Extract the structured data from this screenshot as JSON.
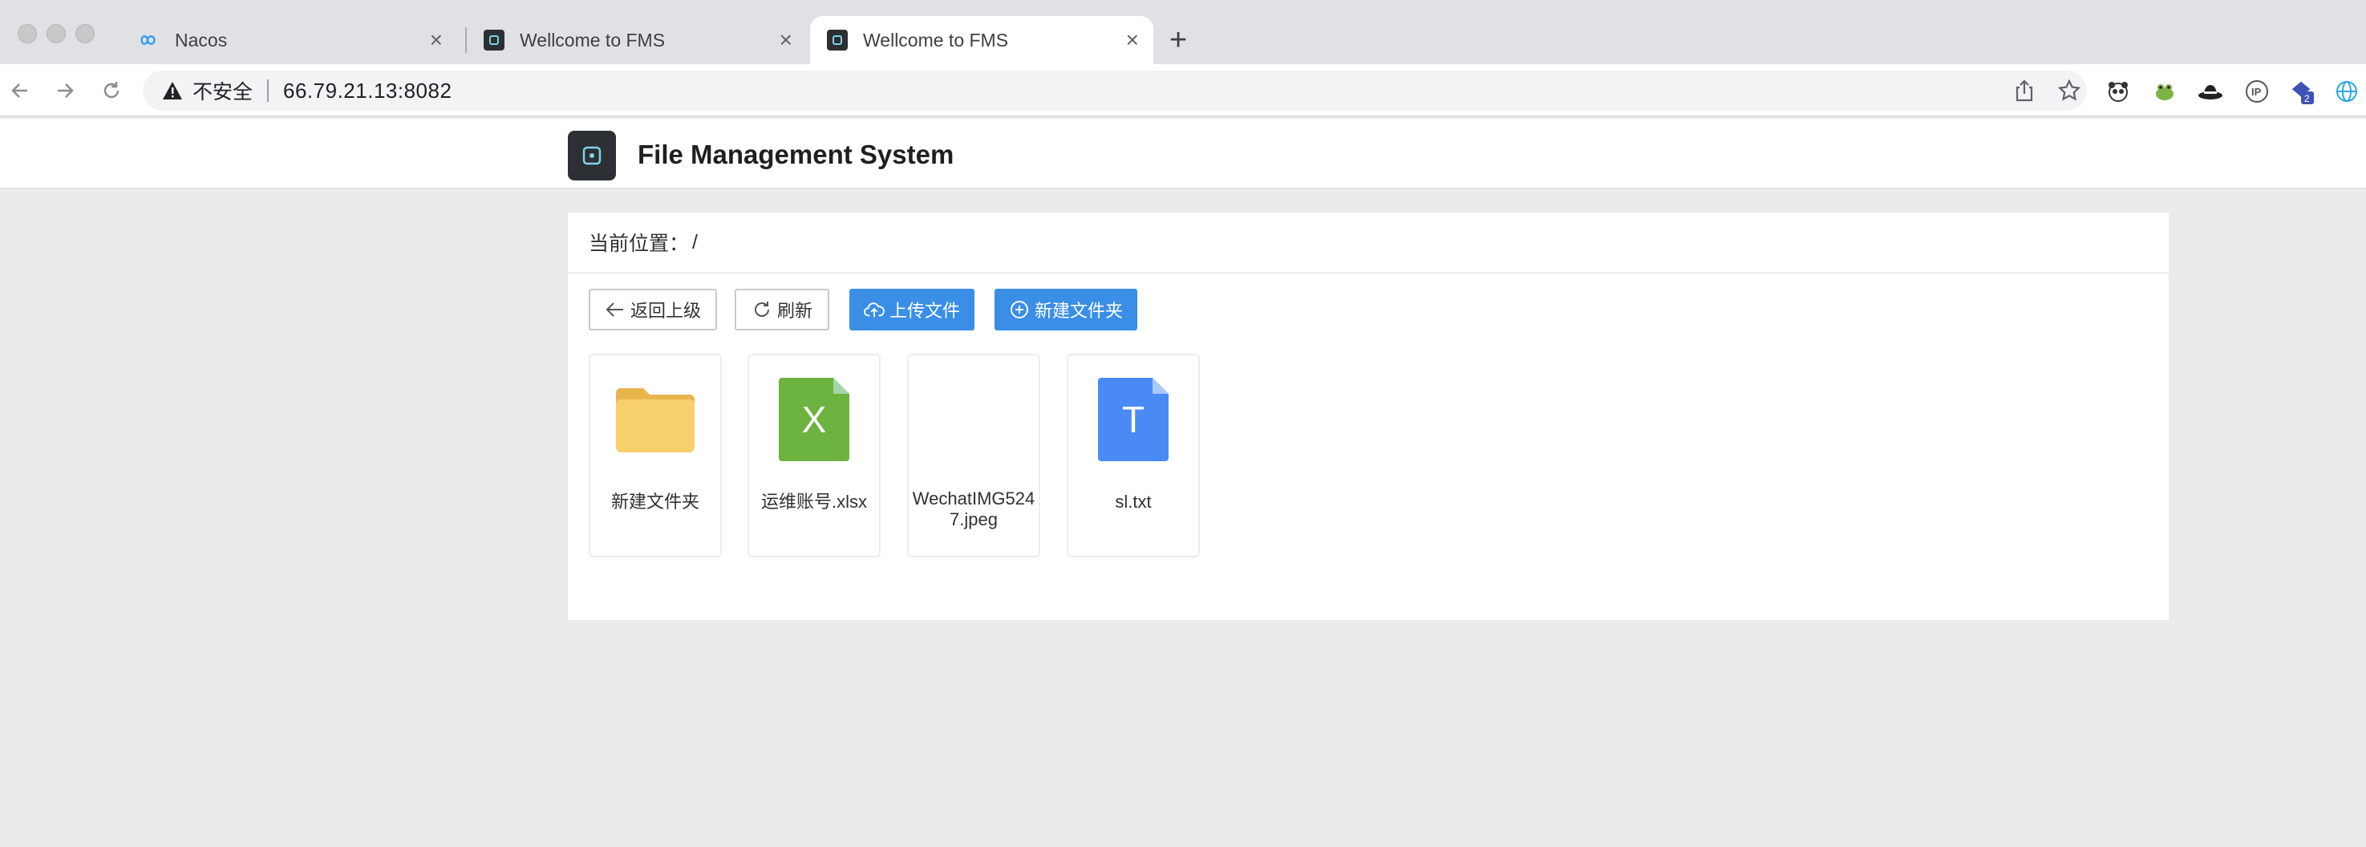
{
  "browser": {
    "tabs": [
      {
        "title": "Nacos",
        "active": false,
        "icon": "nacos-infinity-icon"
      },
      {
        "title": "Wellcome to FMS",
        "active": false,
        "icon": "fms-logo-icon"
      },
      {
        "title": "Wellcome to FMS",
        "active": true,
        "icon": "fms-logo-icon"
      }
    ],
    "new_tab": "+",
    "tab_close": "×",
    "address": {
      "security_label": "不安全",
      "url": "66.79.21.13:8082"
    },
    "extensions": [
      "panda-icon",
      "frog-icon",
      "hat-icon",
      "ip-icon",
      "puzzle-badge-icon",
      "globe-icon"
    ],
    "extension_badge": "2"
  },
  "app": {
    "title": "File Management System"
  },
  "breadcrumb": {
    "label": "当前位置：",
    "path": "/"
  },
  "actions": {
    "back": "返回上级",
    "refresh": "刷新",
    "upload": "上传文件",
    "new_folder": "新建文件夹"
  },
  "files": [
    {
      "name": "新建文件夹",
      "type": "folder"
    },
    {
      "name": "运维账号.xlsx",
      "type": "excel",
      "glyph": "X"
    },
    {
      "name": "WechatIMG5247.jpeg",
      "type": "image"
    },
    {
      "name": "sl.txt",
      "type": "text",
      "glyph": "T"
    }
  ],
  "colors": {
    "primary": "#3a8ee6",
    "folder": "#f7d06b",
    "excel": "#6db33f",
    "text_file": "#4a8af4"
  }
}
